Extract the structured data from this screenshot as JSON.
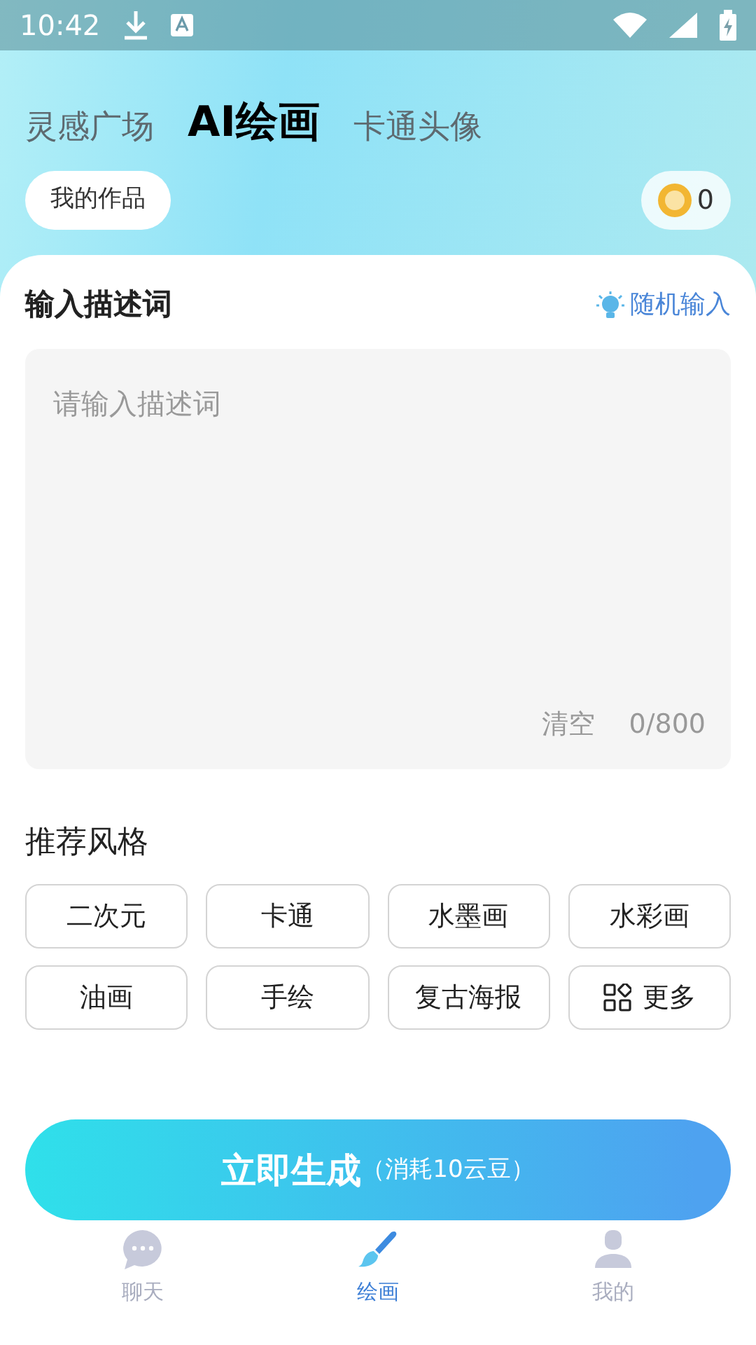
{
  "status_bar": {
    "time": "10:42"
  },
  "tabs": [
    {
      "label": "灵感广场",
      "selected": false
    },
    {
      "label": "AI绘画",
      "selected": true
    },
    {
      "label": "卡通头像",
      "selected": false
    }
  ],
  "my_works": "我的作品",
  "coins": "0",
  "prompt": {
    "title": "输入描述词",
    "random": "随机输入",
    "placeholder": "请输入描述词",
    "clear": "清空",
    "count": "0/800"
  },
  "styles": {
    "title": "推荐风格",
    "items": [
      {
        "label": "二次元",
        "kind": "style"
      },
      {
        "label": "卡通",
        "kind": "style"
      },
      {
        "label": "水墨画",
        "kind": "style"
      },
      {
        "label": "水彩画",
        "kind": "style"
      },
      {
        "label": "油画",
        "kind": "style"
      },
      {
        "label": "手绘",
        "kind": "style"
      },
      {
        "label": "复古海报",
        "kind": "style"
      },
      {
        "label": "更多",
        "kind": "more"
      }
    ]
  },
  "generate": {
    "label": "立即生成",
    "cost": "（消耗10云豆）"
  },
  "nav": [
    {
      "label": "聊天",
      "kind": "chat",
      "selected": false
    },
    {
      "label": "绘画",
      "kind": "brush",
      "selected": true
    },
    {
      "label": "我的",
      "kind": "person",
      "selected": false
    }
  ]
}
